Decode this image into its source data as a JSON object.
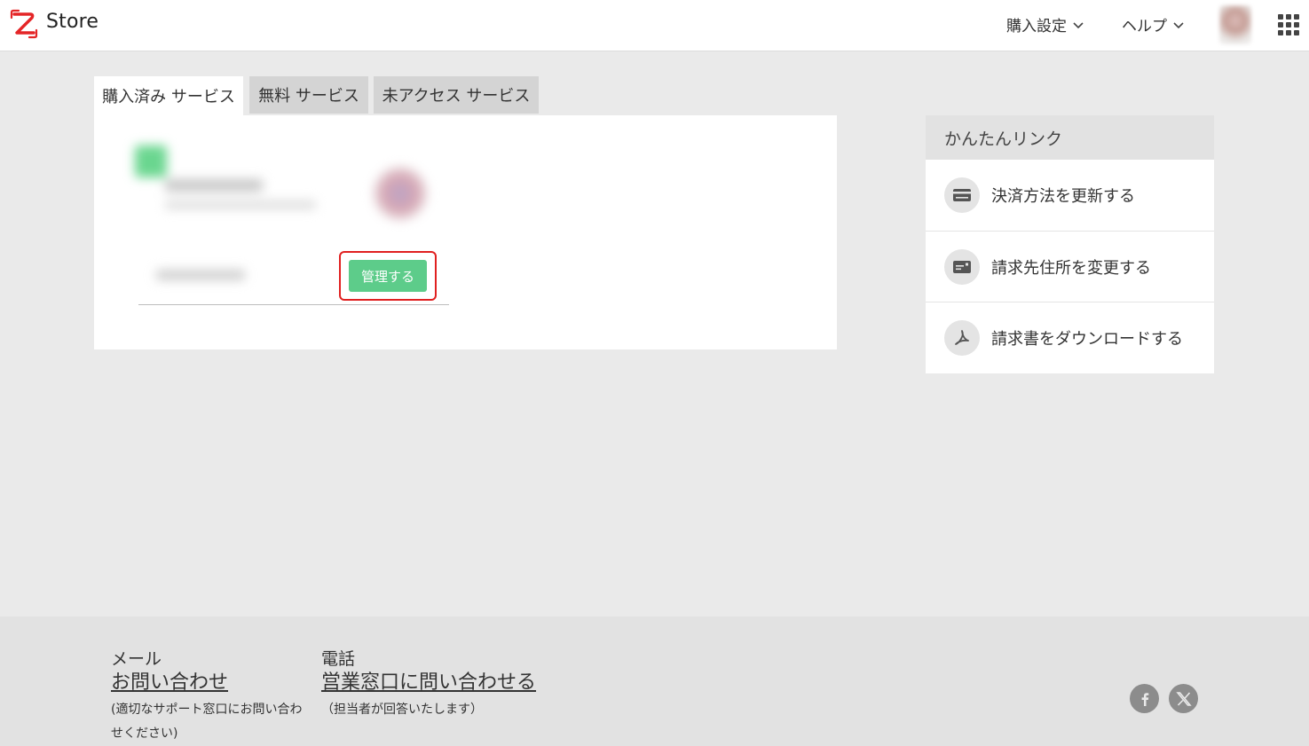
{
  "header": {
    "brand": "Store",
    "menus": [
      {
        "label": "購入設定"
      },
      {
        "label": "ヘルプ"
      }
    ]
  },
  "tabs": [
    {
      "label": "購入済み サービス",
      "active": true
    },
    {
      "label": "無料 サービス",
      "active": false
    },
    {
      "label": "未アクセス サービス",
      "active": false
    }
  ],
  "service_card": {
    "manage_label": "管理する"
  },
  "quick_links": {
    "title": "かんたんリンク",
    "items": [
      {
        "label": "決済方法を更新する",
        "icon": "credit-card-icon"
      },
      {
        "label": "請求先住所を変更する",
        "icon": "address-card-icon"
      },
      {
        "label": "請求書をダウンロードする",
        "icon": "pdf-icon"
      }
    ]
  },
  "footer": {
    "mail": {
      "title": "メール",
      "link": "お問い合わせ",
      "note_line1": "(適切なサポート窓口にお問い合わ",
      "note_line2": "せください)"
    },
    "phone": {
      "title": "電話",
      "link": "営業窓口に問い合わせる",
      "note": "（担当者が回答いたします）"
    }
  },
  "colors": {
    "accent_green": "#5dcc8a",
    "highlight_red": "#e02020",
    "logo_red": "#e42527"
  }
}
